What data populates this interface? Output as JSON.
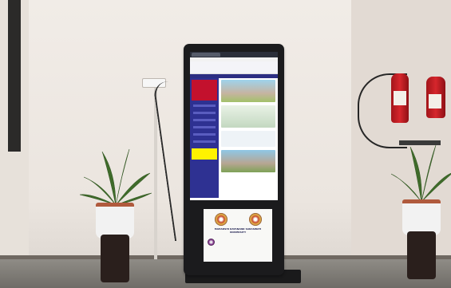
{
  "scene": {
    "kiosk": {
      "placard": {
        "title": "MAHARSHI DAYANAND SARASWATI UNIVERSITY",
        "subtitle": "",
        "college": ""
      }
    }
  }
}
